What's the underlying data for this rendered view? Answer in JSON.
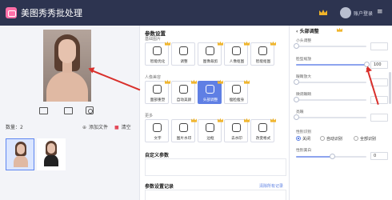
{
  "app": {
    "title": "美图秀秀批处理",
    "user_label": "账户登录",
    "menu_icon": "hamburger-icon"
  },
  "colors": {
    "titlebar": "#2d3450",
    "accent": "#5f7fe4",
    "crown": "#f0b429",
    "arrow": "#d9302c",
    "clear": "#e34a5a"
  },
  "left": {
    "count_label": "数量：2",
    "add_files": "添加文件",
    "clear": "清空",
    "tools": [
      "rotate-left-icon",
      "rotate-right-icon",
      "crop-icon"
    ]
  },
  "middle": {
    "heading": "参数设置",
    "sections": [
      {
        "label": "基础图片",
        "tiles": [
          {
            "label": "智能优化",
            "crown": true
          },
          {
            "label": "调整",
            "crown": false
          },
          {
            "label": "图像裁剪",
            "crown": true
          },
          {
            "label": "人像抠图",
            "crown": true
          },
          {
            "label": "智能抠图",
            "crown": true
          }
        ]
      },
      {
        "label": "人像美容",
        "tiles": [
          {
            "label": "面部重塑",
            "crown": true
          },
          {
            "label": "自动美颜",
            "crown": true
          },
          {
            "label": "头部调整",
            "crown": true,
            "active": true
          },
          {
            "label": "瘦脸瘦身",
            "crown": true
          }
        ]
      },
      {
        "label": "更多",
        "tiles": [
          {
            "label": "文字",
            "crown": false
          },
          {
            "label": "图片水印",
            "crown": true
          },
          {
            "label": "边框",
            "crown": true
          },
          {
            "label": "去水印",
            "crown": true
          },
          {
            "label": "改变格式",
            "crown": true
          }
        ]
      }
    ],
    "custom_title": "自定义参数",
    "records_title": "参数设置记录",
    "records_link": "清除所有记录"
  },
  "right": {
    "heading": "头部调整",
    "sliders": [
      {
        "label": "小头调整",
        "value": null,
        "level": 0.0
      },
      {
        "label": "脸型缩放",
        "value": "100",
        "level": 1.0
      },
      {
        "label": "眼睛放大",
        "value": null,
        "level": 0.0
      },
      {
        "label": "微调眼睛",
        "value": null,
        "level": 0.0
      },
      {
        "label": "亮眼",
        "value": null,
        "level": 0.0
      }
    ],
    "gender_label": "性别识别",
    "radios": [
      "关闭",
      "自动识别",
      "全部识别"
    ],
    "radio_selected": 0,
    "last_label": "性别美白",
    "last_value": "0"
  }
}
